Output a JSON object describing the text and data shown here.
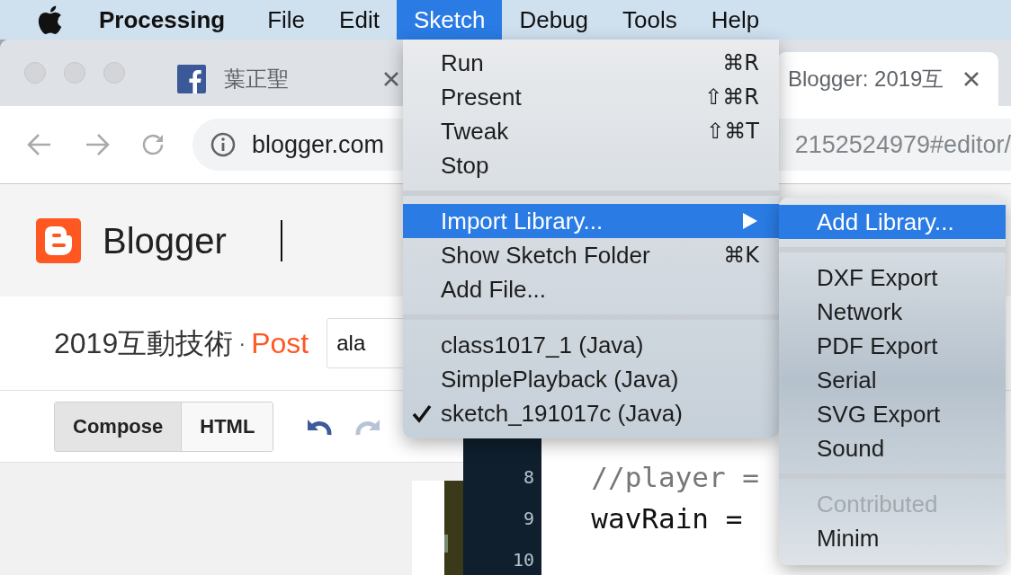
{
  "menu_bar": {
    "app_name": "Processing",
    "items": [
      {
        "label": "File",
        "selected": false
      },
      {
        "label": "Edit",
        "selected": false
      },
      {
        "label": "Sketch",
        "selected": true
      },
      {
        "label": "Debug",
        "selected": false
      },
      {
        "label": "Tools",
        "selected": false
      },
      {
        "label": "Help",
        "selected": false
      }
    ]
  },
  "browser": {
    "tabs": [
      {
        "title": "葉正聖",
        "selected": false
      },
      {
        "title": "Blogger: 2019互",
        "selected": true
      }
    ],
    "url_left": "blogger.com",
    "url_right": "2152524979#editor/",
    "header": {
      "logo_text": "Blogger"
    },
    "post_title": {
      "blog": "2019互動技術",
      "separator": "·",
      "label": "Post",
      "field_value": "ala"
    },
    "editor_modes": [
      {
        "label": "Compose",
        "selected": true
      },
      {
        "label": "HTML",
        "selected": false
      }
    ]
  },
  "code_editor": {
    "lines": [
      {
        "number": "8",
        "code": "  //player =",
        "kind": "comment"
      },
      {
        "number": "9",
        "code": "  wavRain =",
        "kind": "code"
      },
      {
        "number": "10"
      }
    ]
  },
  "sketch_menu": {
    "groups": [
      [
        {
          "label": "Run",
          "shortcut": "⌘R",
          "selected": false,
          "submenu": false,
          "checked": false
        },
        {
          "label": "Present",
          "shortcut": "⇧⌘R",
          "selected": false,
          "submenu": false,
          "checked": false
        },
        {
          "label": "Tweak",
          "shortcut": "⇧⌘T",
          "selected": false,
          "submenu": false,
          "checked": false
        },
        {
          "label": "Stop",
          "selected": false,
          "submenu": false,
          "checked": false
        }
      ],
      [
        {
          "label": "Import Library...",
          "selected": true,
          "submenu": true,
          "checked": false
        },
        {
          "label": "Show Sketch Folder",
          "shortcut": "⌘K",
          "selected": false,
          "submenu": false,
          "checked": false
        },
        {
          "label": "Add File...",
          "selected": false,
          "submenu": false,
          "checked": false
        }
      ],
      [
        {
          "label": "class1017_1 (Java)",
          "selected": false,
          "submenu": false,
          "checked": false
        },
        {
          "label": "SimplePlayback (Java)",
          "selected": false,
          "submenu": false,
          "checked": false
        },
        {
          "label": "sketch_191017c (Java)",
          "selected": false,
          "submenu": false,
          "checked": true
        }
      ]
    ]
  },
  "library_submenu": {
    "groups": [
      [
        {
          "label": "Add Library...",
          "selected": true,
          "disabled": false
        }
      ],
      [
        {
          "label": "DXF Export",
          "selected": false,
          "disabled": false
        },
        {
          "label": "Network",
          "selected": false,
          "disabled": false
        },
        {
          "label": "PDF Export",
          "selected": false,
          "disabled": false
        },
        {
          "label": "Serial",
          "selected": false,
          "disabled": false
        },
        {
          "label": "SVG Export",
          "selected": false,
          "disabled": false
        },
        {
          "label": "Sound",
          "selected": false,
          "disabled": false
        }
      ],
      [
        {
          "label": "Contributed",
          "selected": false,
          "disabled": true
        },
        {
          "label": "Minim",
          "selected": false,
          "disabled": false
        }
      ]
    ]
  }
}
